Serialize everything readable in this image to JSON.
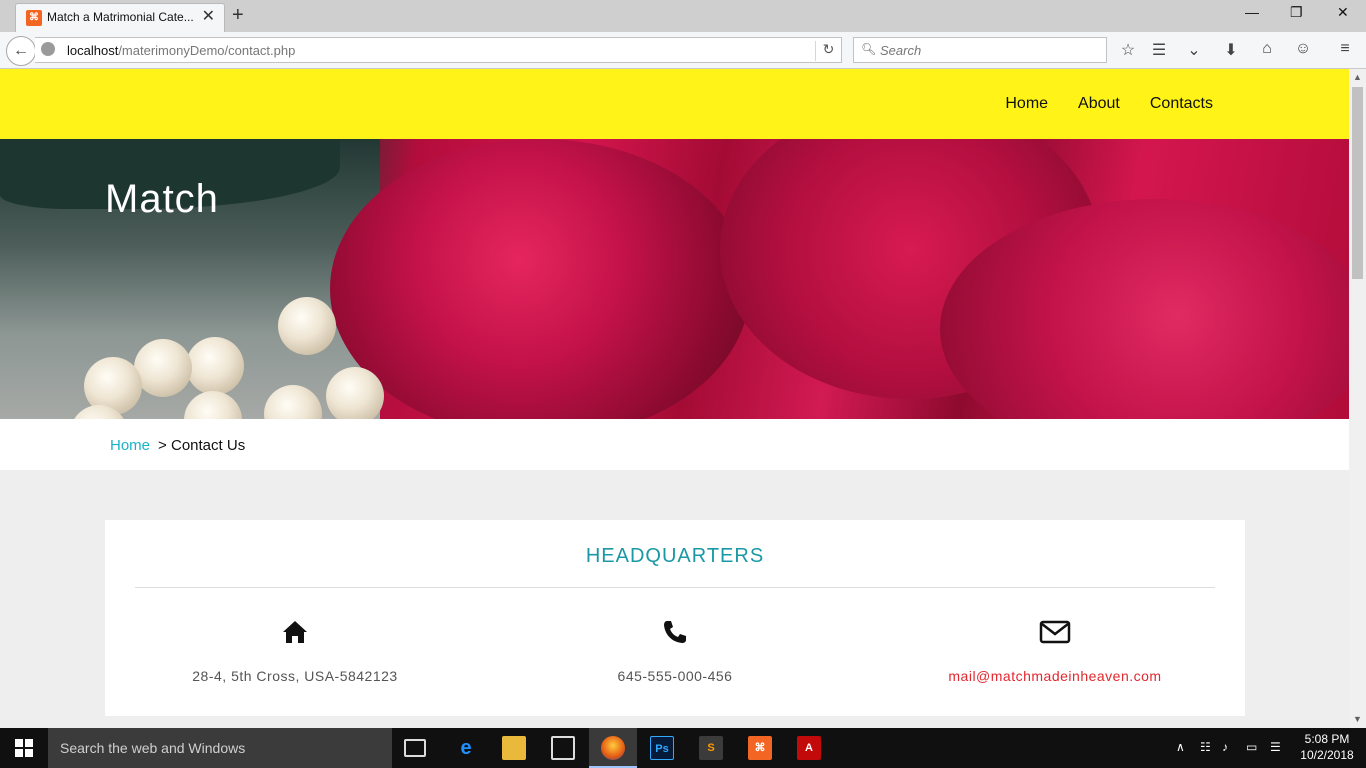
{
  "browser": {
    "tab_title": "Match a Matrimonial Cate...",
    "url_host": "localhost",
    "url_path": "/materimonyDemo/contact.php",
    "search_placeholder": "Search"
  },
  "site": {
    "nav": [
      "Home",
      "About",
      "Contacts"
    ],
    "hero_title": "Match",
    "breadcrumb": {
      "home": "Home",
      "separator": ">",
      "current": "Contact Us"
    },
    "headquarters": {
      "title": "HEADQUARTERS",
      "address": "28-4, 5th Cross, USA-5842123",
      "phone": "645-555-000-456",
      "email": "mail@matchmadeinheaven.com"
    }
  },
  "taskbar": {
    "search_placeholder": "Search the web and Windows",
    "time": "5:08 PM",
    "date": "10/2/2018"
  },
  "colors": {
    "header_bg": "#fff318",
    "accent_teal": "#1b98a6",
    "link_cyan": "#1ab3c6",
    "email_red": "#e2272e"
  }
}
